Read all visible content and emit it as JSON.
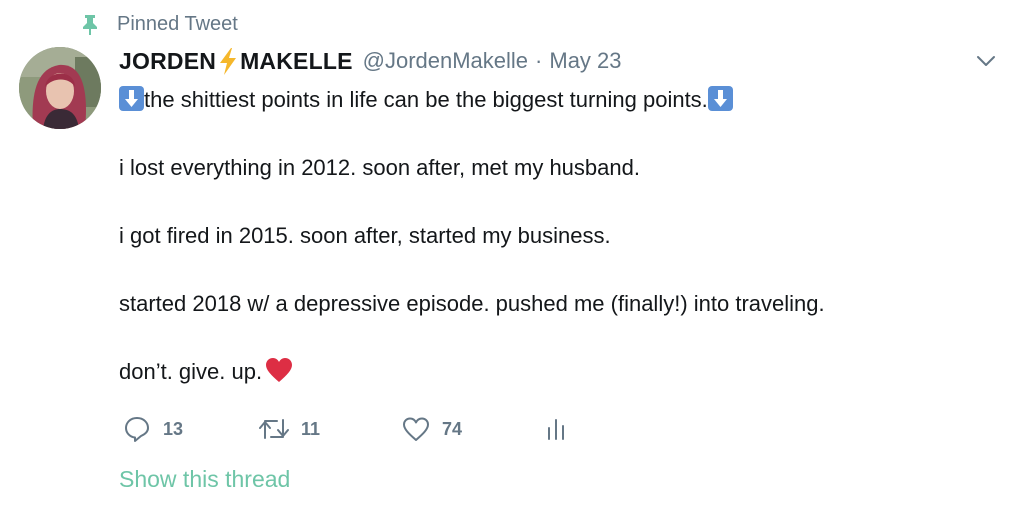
{
  "pinned": {
    "label": "Pinned Tweet",
    "icon": "pin-icon",
    "icon_color": "#6ec5a7"
  },
  "author": {
    "name_part1": "JORDEN",
    "name_emoji": "high-voltage-icon",
    "name_part2": "MAKELLE",
    "handle": "@JordenMakelle",
    "separator": "·",
    "date": "May 23",
    "avatar": "avatar"
  },
  "tweet": {
    "line1": "the shittiest points in life can be the biggest turning points.",
    "line2": "i lost everything in 2012. soon after, met my husband.",
    "line3": "i got fired in 2015. soon after, started my business.",
    "line4": "started 2018 w/ a depressive episode. pushed me (finally!) into traveling.",
    "line5": "don’t. give. up."
  },
  "actions": {
    "replies": "13",
    "retweets": "11",
    "likes": "74"
  },
  "show_thread": "Show this thread",
  "colors": {
    "accent": "#6ec5a7",
    "muted": "#657786",
    "text": "#14171a",
    "heart": "#dd2e44",
    "arrow_emoji": "#5a8fd6"
  }
}
